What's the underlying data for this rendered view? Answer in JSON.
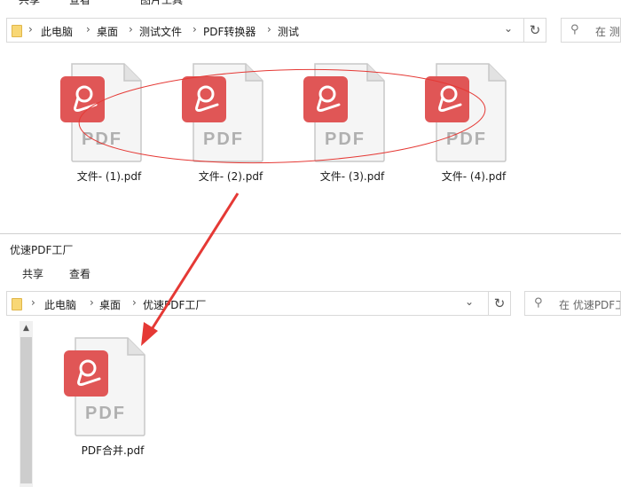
{
  "top_window": {
    "ribbon_tabs": [
      "共享",
      "查看",
      "图片工具"
    ],
    "breadcrumb": [
      "此电脑",
      "桌面",
      "测试文件",
      "PDF转换器",
      "测试"
    ],
    "search_placeholder": "在 测",
    "files": [
      "文件- (1).pdf",
      "文件- (2).pdf",
      "文件- (3).pdf",
      "文件- (4).pdf"
    ]
  },
  "bottom_window": {
    "title": "优速PDF工厂",
    "ribbon_tabs": [
      "共享",
      "查看"
    ],
    "breadcrumb": [
      "此电脑",
      "桌面",
      "优速PDF工厂"
    ],
    "search_placeholder": "在 优速PDF工",
    "files": [
      "PDF合并.pdf"
    ]
  },
  "file_type_label": "PDF",
  "colors": {
    "pdf_badge": "#e05656",
    "annotation": "#e53935"
  }
}
